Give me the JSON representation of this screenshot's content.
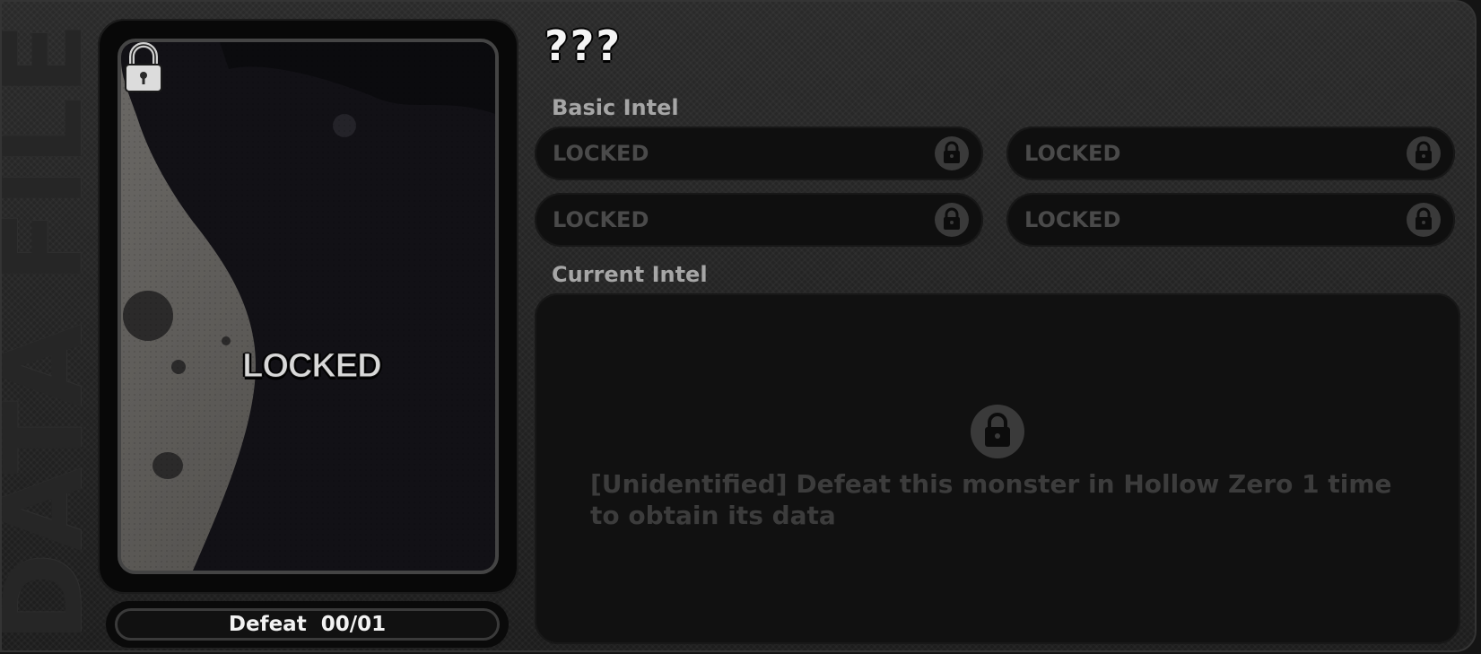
{
  "side_label": "DATA FILE",
  "monster_name": "???",
  "card": {
    "locked_label": "LOCKED",
    "icon": "lock-icon"
  },
  "defeat": {
    "label": "Defeat",
    "count": "00/01",
    "text": "Defeat  00/01"
  },
  "basic_intel": {
    "label": "Basic Intel",
    "slots": [
      {
        "label": "LOCKED",
        "icon": "lock-icon"
      },
      {
        "label": "LOCKED",
        "icon": "lock-icon"
      },
      {
        "label": "LOCKED",
        "icon": "lock-icon"
      },
      {
        "label": "LOCKED",
        "icon": "lock-icon"
      }
    ]
  },
  "current_intel": {
    "label": "Current Intel",
    "icon": "lock-icon",
    "message": "[Unidentified] Defeat this monster in Hollow Zero 1 time to obtain its data"
  },
  "colors": {
    "panel_bg": "#232323",
    "slot_bg": "#0f0f0f",
    "locked_text": "#4a4a4a",
    "label_text": "#a6a6a6",
    "title_text": "#f4f4f4"
  }
}
